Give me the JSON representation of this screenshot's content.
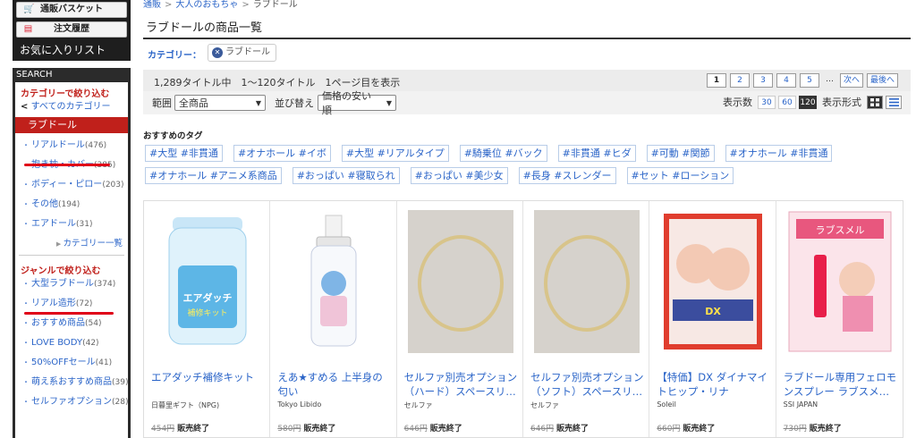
{
  "sidebar": {
    "basket": "通販バスケット",
    "history": "注文履歴",
    "favorites": "お気に入りリスト",
    "search_head": "SEARCH",
    "cat_title": "カテゴリーで絞り込む",
    "all_cats": "すべてのカテゴリー",
    "selected_cat": "ラブドール",
    "cat_items": [
      {
        "label": "リアルドール",
        "count": "(476)"
      },
      {
        "label": "抱き枕・カバー",
        "count": "(385)"
      },
      {
        "label": "ボディー・ピロー",
        "count": "(203)"
      },
      {
        "label": "その他",
        "count": "(194)"
      },
      {
        "label": "エアドール",
        "count": "(31)"
      }
    ],
    "cat_list_link": "カテゴリー一覧",
    "genre_title": "ジャンルで絞り込む",
    "genre_items": [
      {
        "label": "大型ラブドール",
        "count": "(374)"
      },
      {
        "label": "リアル造形",
        "count": "(72)"
      },
      {
        "label": "おすすめ商品",
        "count": "(54)"
      },
      {
        "label": "LOVE BODY",
        "count": "(42)"
      },
      {
        "label": "50%OFFセール",
        "count": "(41)"
      },
      {
        "label": "萌え系おすすめ商品",
        "count": "(39)"
      },
      {
        "label": "セルファオプション",
        "count": "(28)"
      }
    ]
  },
  "breadcrumb": {
    "home": "通販",
    "mid": "大人のおもちゃ",
    "current": "ラブドール",
    "sep": ">"
  },
  "page_title": "ラブドールの商品一覧",
  "category_label": "カテゴリー：",
  "category_chip": "ラブドール",
  "summary": "1,289タイトル中　1～120タイトル　1ページ目を表示",
  "pager": [
    "1",
    "2",
    "3",
    "4",
    "5",
    "…",
    "次へ",
    "最後へ"
  ],
  "filter": {
    "range_label": "範囲",
    "range_value": "全商品",
    "sort_label": "並び替え",
    "sort_value": "価格の安い順"
  },
  "display": {
    "count_label": "表示数",
    "counts": [
      "30",
      "60",
      "120"
    ],
    "format_label": "表示形式"
  },
  "tags_title": "おすすめのタグ",
  "tags": [
    "#大型 #非貫通",
    "#オナホール #イボ",
    "#大型 #リアルタイプ",
    "#騎乗位 #バック",
    "#非貫通 #ヒダ",
    "#可動 #関節",
    "#オナホール #非貫通",
    "#オナホール #アニメ系商品",
    "#おっぱい #寝取られ",
    "#おっぱい #美少女",
    "#長身 #スレンダー",
    "#セット #ローション"
  ],
  "products": [
    {
      "name": "エアダッチ補修キット",
      "maker": "日暮里ギフト（NPG)",
      "price": "454円",
      "status": "販売終了"
    },
    {
      "name": "えあ★すめる 上半身の匂い",
      "maker": "Tokyo Libido",
      "price": "580円",
      "status": "販売終了"
    },
    {
      "name": "セルファ別売オプション（ハード）スペースリ…",
      "maker": "セルファ",
      "price": "646円",
      "status": "販売終了"
    },
    {
      "name": "セルファ別売オプション（ソフト）スペースリ…",
      "maker": "セルファ",
      "price": "646円",
      "status": "販売終了"
    },
    {
      "name": "【特価】DX ダイナマイトヒップ・リナ",
      "maker": "Soleil",
      "price": "660円",
      "status": "販売終了"
    },
    {
      "name": "ラブドール専用フェロモンスプレー ラブスメ…",
      "maker": "SSI JAPAN",
      "price": "730円",
      "status": "販売終了"
    }
  ],
  "colors": {
    "accent": "#2a64c8",
    "red": "#c0201b",
    "underline": "#e00018"
  }
}
